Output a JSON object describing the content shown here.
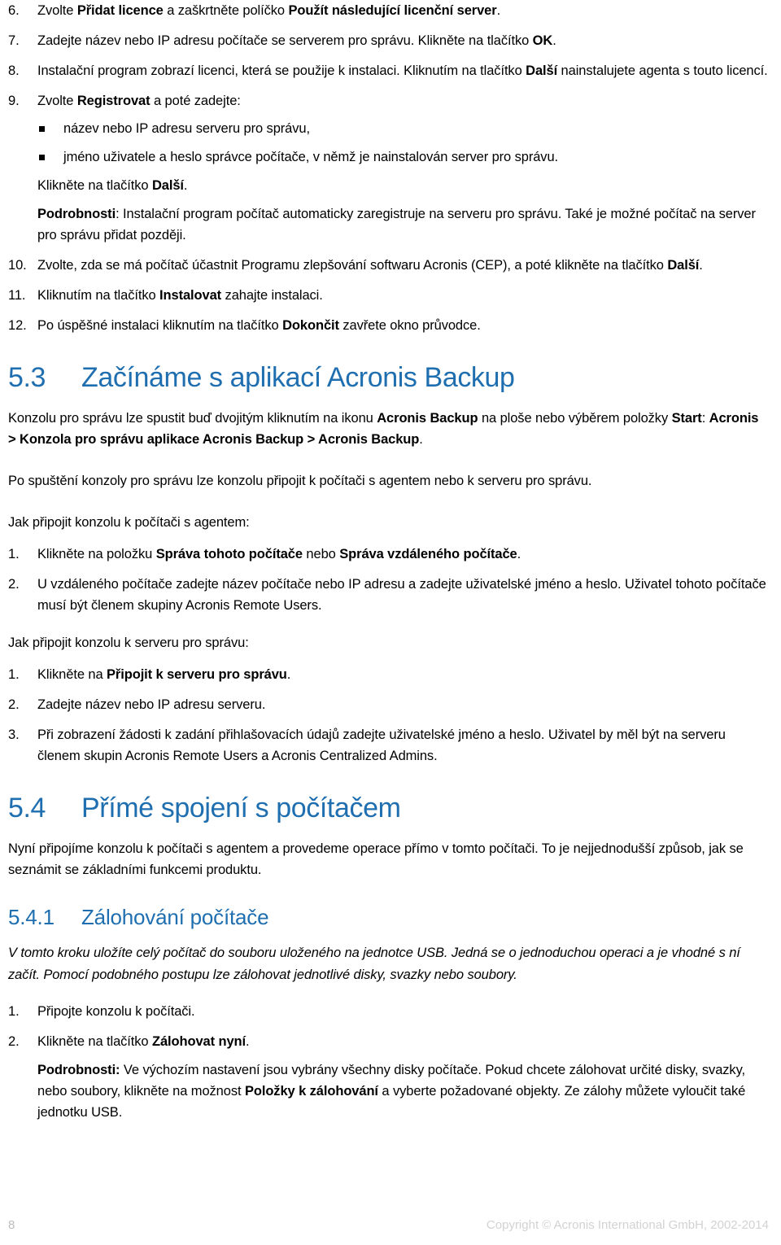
{
  "document": {
    "language": "cs",
    "accent_color": "#1F6FB0",
    "footer_color": "#d2d2d2"
  },
  "install_steps": [
    {
      "num": "6.",
      "parts": [
        {
          "t": "Zvolte ",
          "b": false
        },
        {
          "t": "Přidat licence",
          "b": true
        },
        {
          "t": " a zaškrtněte políčko ",
          "b": false
        },
        {
          "t": "Použít následující licenční server",
          "b": true
        },
        {
          "t": ".",
          "b": false
        }
      ]
    },
    {
      "num": "7.",
      "parts": [
        {
          "t": "Zadejte název nebo IP adresu počítače se serverem pro správu. Klikněte na tlačítko ",
          "b": false
        },
        {
          "t": "OK",
          "b": true
        },
        {
          "t": ".",
          "b": false
        }
      ]
    },
    {
      "num": "8.",
      "parts": [
        {
          "t": "Instalační program zobrazí licenci, která se použije k instalaci. Kliknutím na tlačítko ",
          "b": false
        },
        {
          "t": "Další",
          "b": true
        },
        {
          "t": " nainstalujete agenta s touto licencí.",
          "b": false
        }
      ]
    }
  ],
  "step9": {
    "num": "9.",
    "lead_parts": [
      {
        "t": "Zvolte ",
        "b": false
      },
      {
        "t": "Registrovat",
        "b": true
      },
      {
        "t": " a poté zadejte:",
        "b": false
      }
    ],
    "bullets": [
      "název nebo IP adresu serveru pro správu,",
      "jméno uživatele a heslo správce počítače, v němž je nainstalován server pro správu."
    ],
    "after_parts": [
      {
        "t": "Klikněte na tlačítko ",
        "b": false
      },
      {
        "t": "Další",
        "b": true
      },
      {
        "t": ".",
        "b": false
      }
    ],
    "details_parts": [
      {
        "t": "Podrobnosti",
        "b": true
      },
      {
        "t": ": Instalační program počítač automaticky zaregistruje na serveru pro správu. Také je možné počítač na server pro správu přidat později.",
        "b": false
      }
    ]
  },
  "install_steps_tail": [
    {
      "num": "10.",
      "parts": [
        {
          "t": "Zvolte, zda se má počítač účastnit Programu zlepšování softwaru Acronis (CEP), a poté klikněte na tlačítko ",
          "b": false
        },
        {
          "t": "Další",
          "b": true
        },
        {
          "t": ".",
          "b": false
        }
      ]
    },
    {
      "num": "11.",
      "parts": [
        {
          "t": "Kliknutím na tlačítko ",
          "b": false
        },
        {
          "t": "Instalovat",
          "b": true
        },
        {
          "t": " zahajte instalaci.",
          "b": false
        }
      ]
    },
    {
      "num": "12.",
      "parts": [
        {
          "t": "Po úspěšné instalaci kliknutím na tlačítko ",
          "b": false
        },
        {
          "t": "Dokončit",
          "b": true
        },
        {
          "t": " zavřete okno průvodce.",
          "b": false
        }
      ]
    }
  ],
  "section_53": {
    "number": "5.3",
    "title": "Začínáme s aplikací Acronis Backup",
    "para1_parts": [
      {
        "t": "Konzolu pro správu lze spustit buď dvojitým kliknutím na ikonu ",
        "b": false
      },
      {
        "t": "Acronis Backup",
        "b": true
      },
      {
        "t": " na ploše nebo výběrem položky ",
        "b": false
      },
      {
        "t": "Start",
        "b": true
      },
      {
        "t": ": ",
        "b": false
      },
      {
        "t": "Acronis > Konzola pro správu aplikace Acronis Backup > Acronis Backup",
        "b": true
      },
      {
        "t": ".",
        "b": false
      }
    ],
    "para2": "Po spuštění konzoly pro správu lze konzolu připojit k počítači s agentem nebo k serveru pro správu.",
    "subhead_agent": "Jak připojit konzolu k počítači s agentem:",
    "agent_steps": [
      {
        "num": "1.",
        "parts": [
          {
            "t": "Klikněte na položku ",
            "b": false
          },
          {
            "t": "Správa tohoto počítače",
            "b": true
          },
          {
            "t": " nebo ",
            "b": false
          },
          {
            "t": "Správa vzdáleného počítače",
            "b": true
          },
          {
            "t": ".",
            "b": false
          }
        ]
      },
      {
        "num": "2.",
        "parts": [
          {
            "t": "U vzdáleného počítače zadejte název počítače nebo IP adresu a zadejte uživatelské jméno a heslo. Uživatel tohoto počítače musí být členem skupiny Acronis Remote Users.",
            "b": false
          }
        ]
      }
    ],
    "subhead_server": "Jak připojit konzolu k serveru pro správu:",
    "server_steps": [
      {
        "num": "1.",
        "parts": [
          {
            "t": "Klikněte na ",
            "b": false
          },
          {
            "t": "Připojit k serveru pro správu",
            "b": true
          },
          {
            "t": ".",
            "b": false
          }
        ]
      },
      {
        "num": "2.",
        "parts": [
          {
            "t": "Zadejte název nebo IP adresu serveru.",
            "b": false
          }
        ]
      },
      {
        "num": "3.",
        "parts": [
          {
            "t": "Při zobrazení žádosti k zadání přihlašovacích údajů zadejte uživatelské jméno a heslo. Uživatel by měl být na serveru členem skupin Acronis Remote Users a Acronis Centralized Admins.",
            "b": false
          }
        ]
      }
    ]
  },
  "section_54": {
    "number": "5.4",
    "title": "Přímé spojení s počítačem",
    "para1": "Nyní připojíme konzolu k počítači s agentem a provedeme operace přímo v tomto počítači. To je nejjednodušší způsob, jak se seznámit se základními funkcemi produktu."
  },
  "section_541": {
    "number": "5.4.1",
    "title": "Zálohování počítače",
    "intro_italic": "V tomto kroku uložíte celý počítač do souboru uloženého na jednotce USB. Jedná se o jednoduchou operaci a je vhodné s ní začít. Pomocí podobného postupu lze zálohovat jednotlivé disky, svazky nebo soubory.",
    "steps": [
      {
        "num": "1.",
        "parts": [
          {
            "t": "Připojte konzolu k počítači.",
            "b": false
          }
        ]
      },
      {
        "num": "2.",
        "parts": [
          {
            "t": "Klikněte na tlačítko ",
            "b": false
          },
          {
            "t": "Zálohovat nyní",
            "b": true
          },
          {
            "t": ".",
            "b": false
          }
        ],
        "details_parts": [
          {
            "t": "Podrobnosti:",
            "b": true
          },
          {
            "t": " Ve výchozím nastavení jsou vybrány všechny disky počítače. Pokud chcete zálohovat určité disky, svazky, nebo soubory, klikněte na možnost ",
            "b": false
          },
          {
            "t": "Položky k zálohování",
            "b": true
          },
          {
            "t": " a vyberte požadované objekty. Ze zálohy můžete vyloučit také jednotku USB.",
            "b": false
          }
        ]
      }
    ]
  },
  "footer": {
    "page_number": "8",
    "copyright": "Copyright © Acronis International GmbH, 2002-2014"
  }
}
